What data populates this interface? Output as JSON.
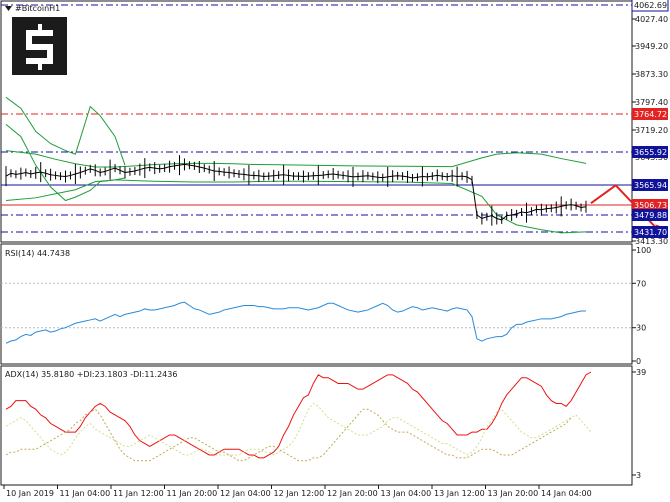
{
  "header": {
    "menu_icon": "triangle-down-icon",
    "symbol_label": "#BitcoinH1"
  },
  "logo": {
    "icon": "brand-s-logo",
    "bg": "#1b1b1b"
  },
  "colors": {
    "price": "#000000",
    "bands": "#1e9d3a",
    "rsi": "#2a8ad8",
    "adx": "#ee1111",
    "plus_di": "#cfe08a",
    "minus_di": "#c2a850",
    "blue_level": "#10129a",
    "red_level": "#e32222",
    "forecast_arrow": "#e32222"
  },
  "chart_data": [
    {
      "type": "line",
      "panel": "price",
      "y_ticks": [
        "4027.40",
        "3949.20",
        "3873.30",
        "3797.40",
        "3719.20",
        "3643.30",
        "3413.30"
      ],
      "ylim": [
        3413.3,
        4062.69
      ],
      "x_labels": [
        "10 Jan 2019",
        "11 Jan 04:00",
        "11 Jan 12:00",
        "11 Jan 20:00",
        "12 Jan 04:00",
        "12 Jan 12:00",
        "12 Jan 20:00",
        "13 Jan 04:00",
        "13 Jan 12:00",
        "13 Jan 20:00",
        "14 Jan 04:00"
      ],
      "levels": [
        {
          "value": 4062.69,
          "label": "4062.69",
          "style": "dashdot",
          "color": "#10129a",
          "pill": false
        },
        {
          "value": 3764.72,
          "label": "3764.72",
          "style": "dashdot",
          "color": "#e32222",
          "pill": true
        },
        {
          "value": 3655.92,
          "label": "3655.92",
          "style": "dashdot",
          "color": "#10129a",
          "pill": true
        },
        {
          "value": 3565.94,
          "label": "3565.94",
          "style": "solid",
          "color": "#10129a",
          "pill": true
        },
        {
          "value": 3506.73,
          "label": "3506.73",
          "style": "solid",
          "color": "#e32222",
          "pill": true
        },
        {
          "value": 3479.88,
          "label": "3479.88",
          "style": "dashdot",
          "color": "#10129a",
          "pill": true
        },
        {
          "value": 3431.7,
          "label": "3431.70",
          "style": "dashdot",
          "color": "#10129a",
          "pill": true
        }
      ],
      "close": [
        3590,
        3598,
        3595,
        3597,
        3600,
        3596,
        3599,
        3601,
        3598,
        3594,
        3592,
        3590,
        3589,
        3592,
        3596,
        3600,
        3605,
        3610,
        3606,
        3600,
        3603,
        3608,
        3612,
        3606,
        3600,
        3602,
        3604,
        3608,
        3612,
        3614,
        3612,
        3610,
        3612,
        3616,
        3618,
        3620,
        3622,
        3620,
        3618,
        3615,
        3612,
        3608,
        3604,
        3603,
        3601,
        3600,
        3598,
        3596,
        3595,
        3593,
        3592,
        3591,
        3589,
        3590,
        3591,
        3593,
        3594,
        3592,
        3590,
        3590,
        3589,
        3590,
        3591,
        3592,
        3593,
        3595,
        3596,
        3594,
        3592,
        3590,
        3588,
        3589,
        3590,
        3591,
        3589,
        3587,
        3586,
        3588,
        3590,
        3591,
        3590,
        3588,
        3585,
        3587,
        3589,
        3588,
        3590,
        3592,
        3590,
        3588,
        3591,
        3589,
        3590,
        3588,
        3580,
        3480,
        3470,
        3475,
        3478,
        3470,
        3466,
        3478,
        3480,
        3483,
        3488,
        3486,
        3490,
        3495,
        3494,
        3497,
        3498,
        3500,
        3503,
        3506,
        3508,
        3505,
        3500,
        3502
      ],
      "bb_upper": {
        "x": [
          0,
          6,
          10,
          14,
          18,
          22,
          26,
          30,
          34,
          38,
          42,
          46,
          50,
          55,
          60,
          70,
          80,
          90,
          96,
          99,
          103,
          108,
          112,
          117
        ],
        "y": [
          3660,
          3650,
          3636,
          3624,
          3615,
          3615,
          3618,
          3622,
          3624,
          3625,
          3625,
          3624,
          3622,
          3621,
          3620,
          3618,
          3617,
          3616,
          3640,
          3650,
          3654,
          3650,
          3638,
          3625
        ]
      },
      "bb_lower": {
        "x": [
          0,
          6,
          10,
          14,
          18,
          22,
          26,
          30,
          34,
          38,
          42,
          46,
          50,
          55,
          60,
          70,
          80,
          90,
          96,
          99,
          103,
          108,
          112,
          117
        ],
        "y": [
          3520,
          3528,
          3540,
          3552,
          3575,
          3580,
          3578,
          3576,
          3575,
          3574,
          3574,
          3574,
          3575,
          3576,
          3576,
          3575,
          3574,
          3570,
          3532,
          3480,
          3452,
          3438,
          3430,
          3432
        ]
      },
      "bb_upper_wide": {
        "x": [
          0,
          3,
          6,
          9,
          12,
          14,
          17,
          19,
          22,
          24
        ],
        "y": [
          3810,
          3780,
          3715,
          3680,
          3660,
          3650,
          3785,
          3760,
          3700,
          3620
        ]
      },
      "bb_lower_wide": {
        "x": [
          0,
          3,
          6,
          9,
          12,
          14,
          17,
          19,
          22,
          24
        ],
        "y": [
          3735,
          3700,
          3620,
          3560,
          3520,
          3530,
          3550,
          3575,
          3580,
          3585
        ]
      },
      "forecast_path": {
        "x": [
          118,
          123,
          132
        ],
        "y": [
          3512,
          3565,
          3431
        ]
      }
    },
    {
      "type": "line",
      "panel": "rsi",
      "title": "RSI(14) 44.7438",
      "y_ticks": [
        "100",
        "70",
        "30",
        "0"
      ],
      "ylim": [
        0,
        100
      ],
      "levels": [
        30,
        70
      ],
      "series": [
        {
          "values": [
            16,
            18,
            19,
            22,
            24,
            23,
            26,
            27,
            28,
            26,
            27,
            29,
            30,
            32,
            34,
            35,
            36,
            37,
            38,
            36,
            38,
            40,
            42,
            40,
            42,
            43,
            44,
            45,
            47,
            46,
            46,
            47,
            48,
            49,
            50,
            52,
            53,
            50,
            47,
            46,
            44,
            42,
            43,
            44,
            46,
            47,
            48,
            49,
            50,
            50,
            50,
            49,
            49,
            48,
            47,
            47,
            47,
            48,
            48,
            48,
            47,
            46,
            47,
            48,
            50,
            52,
            52,
            50,
            48,
            46,
            45,
            44,
            45,
            46,
            48,
            50,
            52,
            50,
            46,
            44,
            45,
            47,
            49,
            48,
            46,
            47,
            48,
            47,
            46,
            45,
            47,
            48,
            47,
            46,
            40,
            20,
            18,
            20,
            21,
            22,
            22,
            24,
            30,
            33,
            33,
            35,
            36,
            37,
            38,
            38,
            38,
            39,
            40,
            42,
            43,
            44,
            45,
            45
          ]
        }
      ]
    },
    {
      "type": "line",
      "panel": "adx",
      "title": "ADX(14) 35.8180 +DI:23.1803 -DI:11.2436",
      "y_ticks": [
        "39",
        "3"
      ],
      "ylim": [
        3,
        39
      ],
      "series": [
        {
          "values": [
            26,
            27,
            29,
            29,
            29,
            27,
            26,
            24,
            23,
            21,
            20,
            19,
            18,
            18,
            18,
            20,
            23,
            25,
            27,
            28,
            27,
            25,
            24,
            23,
            22,
            20,
            17,
            15,
            14,
            13,
            14,
            15,
            16,
            17,
            17,
            16,
            15,
            14,
            13,
            12,
            11,
            10,
            10,
            11,
            12,
            12,
            12,
            12,
            11,
            10,
            10,
            9,
            9,
            10,
            11,
            13,
            17,
            20,
            24,
            27,
            30,
            31,
            35,
            38,
            37,
            37,
            36,
            35,
            35,
            35,
            34,
            33,
            33,
            34,
            35,
            36,
            37,
            38,
            38,
            37,
            36,
            35,
            33,
            32,
            30,
            28,
            26,
            24,
            22,
            21,
            19,
            17,
            17,
            17,
            18,
            18,
            19,
            19,
            21,
            24,
            28,
            31,
            33,
            35,
            37,
            37,
            36,
            35,
            34,
            31,
            29,
            28,
            28,
            27,
            29,
            32,
            35,
            38,
            39
          ]
        },
        {
          "values": [
            20,
            21,
            22,
            23,
            22,
            20,
            18,
            16,
            14,
            12,
            11,
            10,
            11,
            13,
            16,
            18,
            20,
            21,
            19,
            18,
            17,
            16,
            15,
            14,
            13,
            13,
            14,
            15,
            16,
            17,
            16,
            15,
            14,
            13,
            12,
            11,
            10,
            10,
            11,
            12,
            12,
            11,
            10,
            10,
            10,
            10,
            10,
            10,
            11,
            12,
            12,
            12,
            11,
            11,
            10,
            11,
            12,
            13,
            15,
            18,
            22,
            26,
            28,
            27,
            25,
            23,
            22,
            21,
            20,
            19,
            18,
            17,
            17,
            17,
            18,
            19,
            20,
            22,
            23,
            23,
            22,
            21,
            20,
            19,
            18,
            17,
            16,
            15,
            14,
            14,
            13,
            12,
            11,
            10,
            11,
            13,
            16,
            20,
            22,
            25,
            26,
            24,
            22,
            20,
            18,
            17,
            16,
            16,
            17,
            18,
            19,
            20,
            21,
            22,
            23,
            24,
            22,
            20,
            18
          ]
        },
        {
          "values": [
            10,
            11,
            11,
            12,
            12,
            12,
            12,
            13,
            14,
            15,
            16,
            17,
            18,
            19,
            21,
            22,
            24,
            25,
            26,
            24,
            21,
            18,
            15,
            12,
            10,
            9,
            8,
            8,
            8,
            8,
            9,
            10,
            11,
            12,
            13,
            14,
            15,
            16,
            16,
            15,
            14,
            13,
            12,
            11,
            11,
            10,
            9,
            8,
            8,
            9,
            10,
            11,
            12,
            13,
            13,
            12,
            11,
            10,
            9,
            8,
            8,
            8,
            9,
            9,
            10,
            12,
            14,
            16,
            18,
            20,
            22,
            24,
            26,
            26,
            25,
            24,
            22,
            20,
            19,
            18,
            18,
            18,
            17,
            16,
            15,
            14,
            13,
            12,
            11,
            10,
            10,
            9,
            9,
            9,
            10,
            11,
            12,
            12,
            12,
            11,
            10,
            10,
            10,
            11,
            12,
            13,
            14,
            15,
            16,
            17,
            18,
            19,
            20,
            21,
            23
          ]
        }
      ]
    }
  ]
}
